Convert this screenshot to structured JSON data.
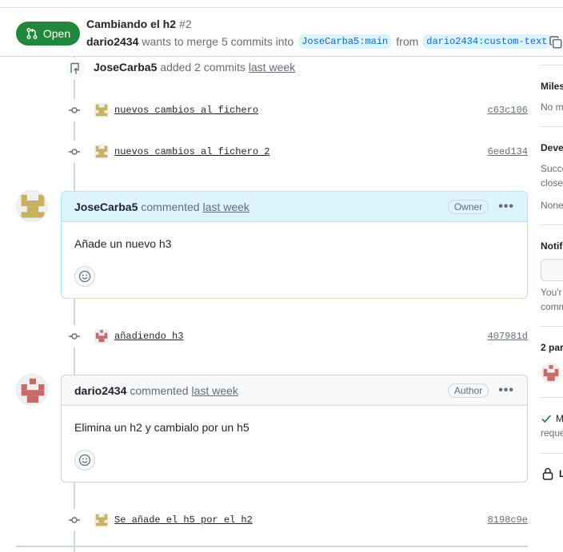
{
  "header": {
    "state_label": "Open",
    "title": "Cambiando el h2",
    "number": "#2",
    "author": "dario2434",
    "merge_text": "wants to merge 5 commits into",
    "base_branch": "JoseCarba5:main",
    "from_text": "from",
    "head_branch": "dario2434:custom-text"
  },
  "timeline": {
    "added_event": {
      "actor": "JoseCarba5",
      "action": "added 2 commits",
      "time": "last week"
    },
    "commits_1": [
      {
        "message": "nuevos cambios al fichero",
        "sha": "c63c106"
      },
      {
        "message": "nuevos cambios al fichero 2",
        "sha": "6eed134"
      }
    ],
    "comment_1": {
      "author": "JoseCarba5",
      "action": "commented",
      "time": "last week",
      "role": "Owner",
      "body": "Añade un nuevo h3"
    },
    "commit_2": {
      "message": "añadiendo h3",
      "sha": "407981d"
    },
    "comment_2": {
      "author": "dario2434",
      "action": "commented",
      "time": "last week",
      "role": "Author",
      "body": "Elimina un h2 y cambialo por un h5"
    },
    "commit_3": {
      "message": "Se añade el h5 por el h2",
      "sha": "8198c9e"
    }
  },
  "sidebar": {
    "milestone_head": "Miles",
    "milestone_val": "No m",
    "dev_head": "Deve",
    "dev_text_1": "Succe",
    "dev_text_2": "close",
    "dev_none": "None",
    "notif_head": "Notif",
    "notif_text_1": "You'r",
    "notif_text_2": "comm",
    "participants_head": "2 par",
    "check_text_1": "M",
    "check_text_2": "reque",
    "lock_text": "L"
  },
  "colors": {
    "open_green": "#1f883d",
    "link_blue": "#0969da",
    "owner_header": "#ddf4ff"
  }
}
